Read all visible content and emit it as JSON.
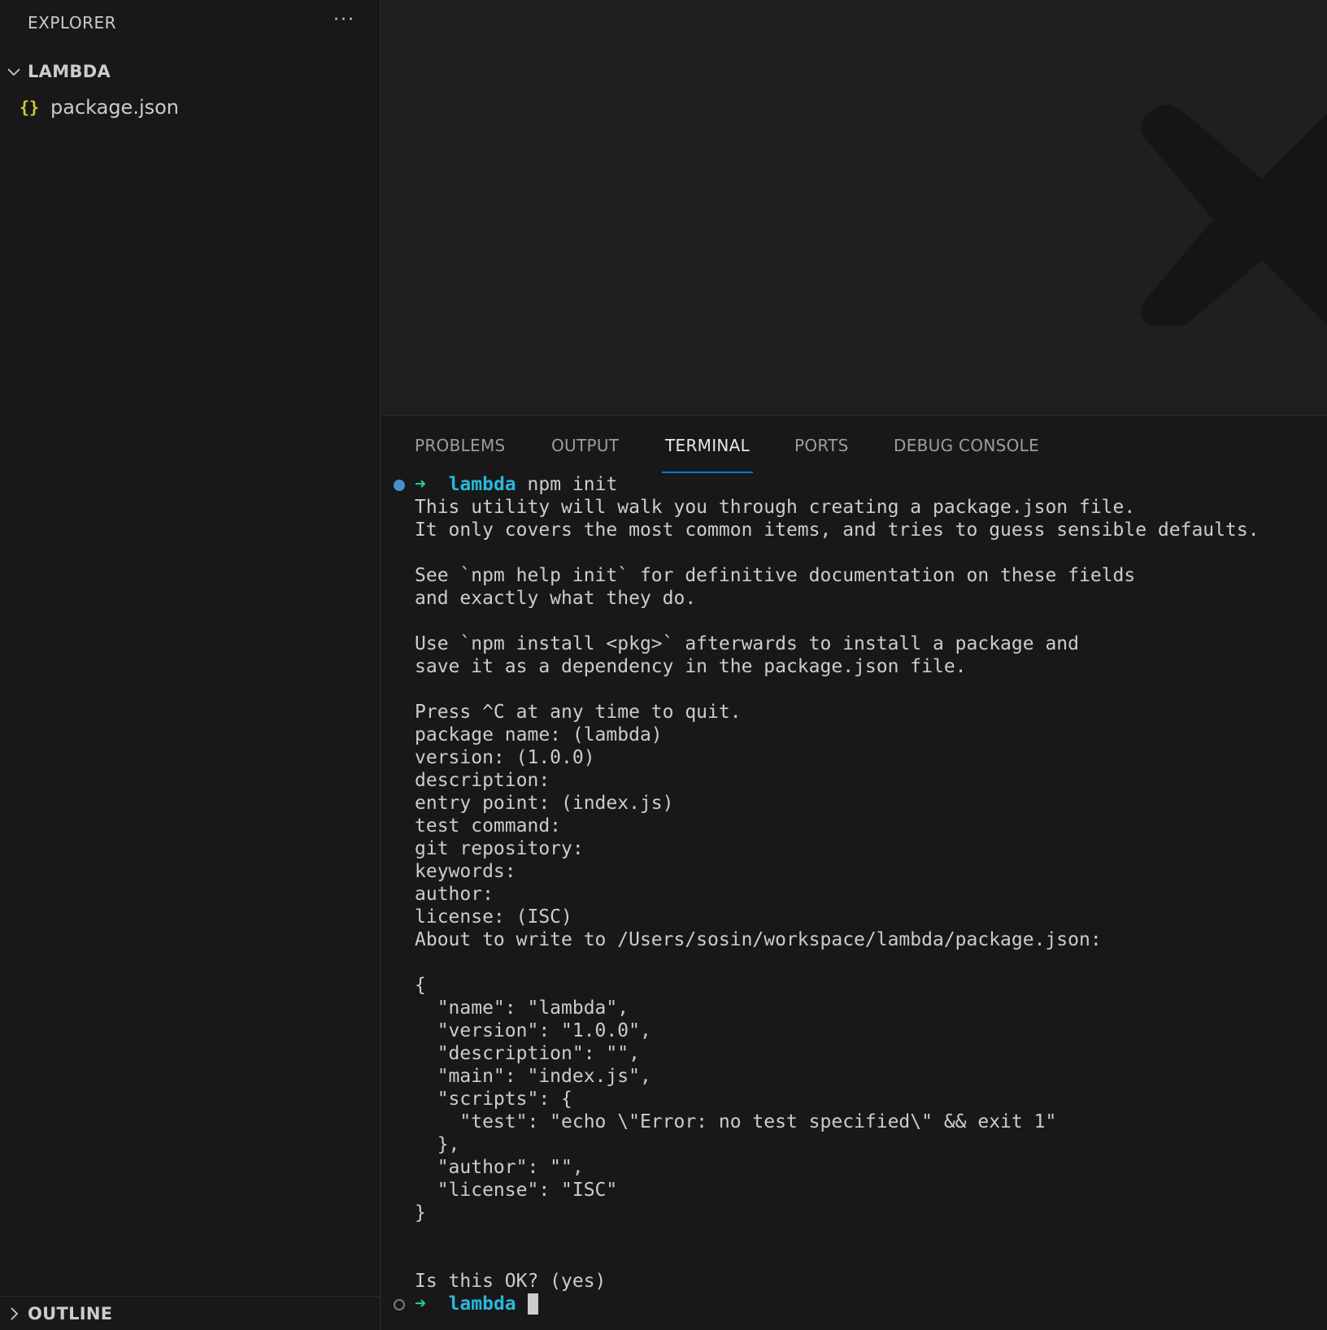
{
  "sidebar": {
    "title": "EXPLORER",
    "more_glyph": "···",
    "folder": {
      "label": "LAMBDA",
      "expanded": true
    },
    "files": [
      {
        "label": "package.json",
        "icon": "json-braces-icon",
        "icon_glyph": "{}"
      }
    ],
    "outline_label": "OUTLINE"
  },
  "panel": {
    "tabs": [
      {
        "label": "PROBLEMS"
      },
      {
        "label": "OUTPUT"
      },
      {
        "label": "TERMINAL",
        "active": true
      },
      {
        "label": "PORTS"
      },
      {
        "label": "DEBUG CONSOLE"
      }
    ]
  },
  "terminal": {
    "prompt_arrow": "➜",
    "first_prompt": {
      "dir": "lambda",
      "command": "npm init"
    },
    "lines": [
      "This utility will walk you through creating a package.json file.",
      "It only covers the most common items, and tries to guess sensible defaults.",
      "",
      "See `npm help init` for definitive documentation on these fields",
      "and exactly what they do.",
      "",
      "Use `npm install <pkg>` afterwards to install a package and",
      "save it as a dependency in the package.json file.",
      "",
      "Press ^C at any time to quit.",
      "package name: (lambda)",
      "version: (1.0.0)",
      "description:",
      "entry point: (index.js)",
      "test command:",
      "git repository:",
      "keywords:",
      "author:",
      "license: (ISC)",
      "About to write to /Users/sosin/workspace/lambda/package.json:",
      "",
      "{",
      "  \"name\": \"lambda\",",
      "  \"version\": \"1.0.0\",",
      "  \"description\": \"\",",
      "  \"main\": \"index.js\",",
      "  \"scripts\": {",
      "    \"test\": \"echo \\\"Error: no test specified\\\" && exit 1\"",
      "  },",
      "  \"author\": \"\",",
      "  \"license\": \"ISC\"",
      "}",
      "",
      "",
      "Is this OK? (yes)"
    ],
    "last_prompt": {
      "dir": "lambda"
    }
  },
  "colors": {
    "accent": "#0078d4",
    "prompt_arrow": "#23d18b",
    "prompt_dir": "#29b8db",
    "json_icon": "#cbcb41"
  }
}
